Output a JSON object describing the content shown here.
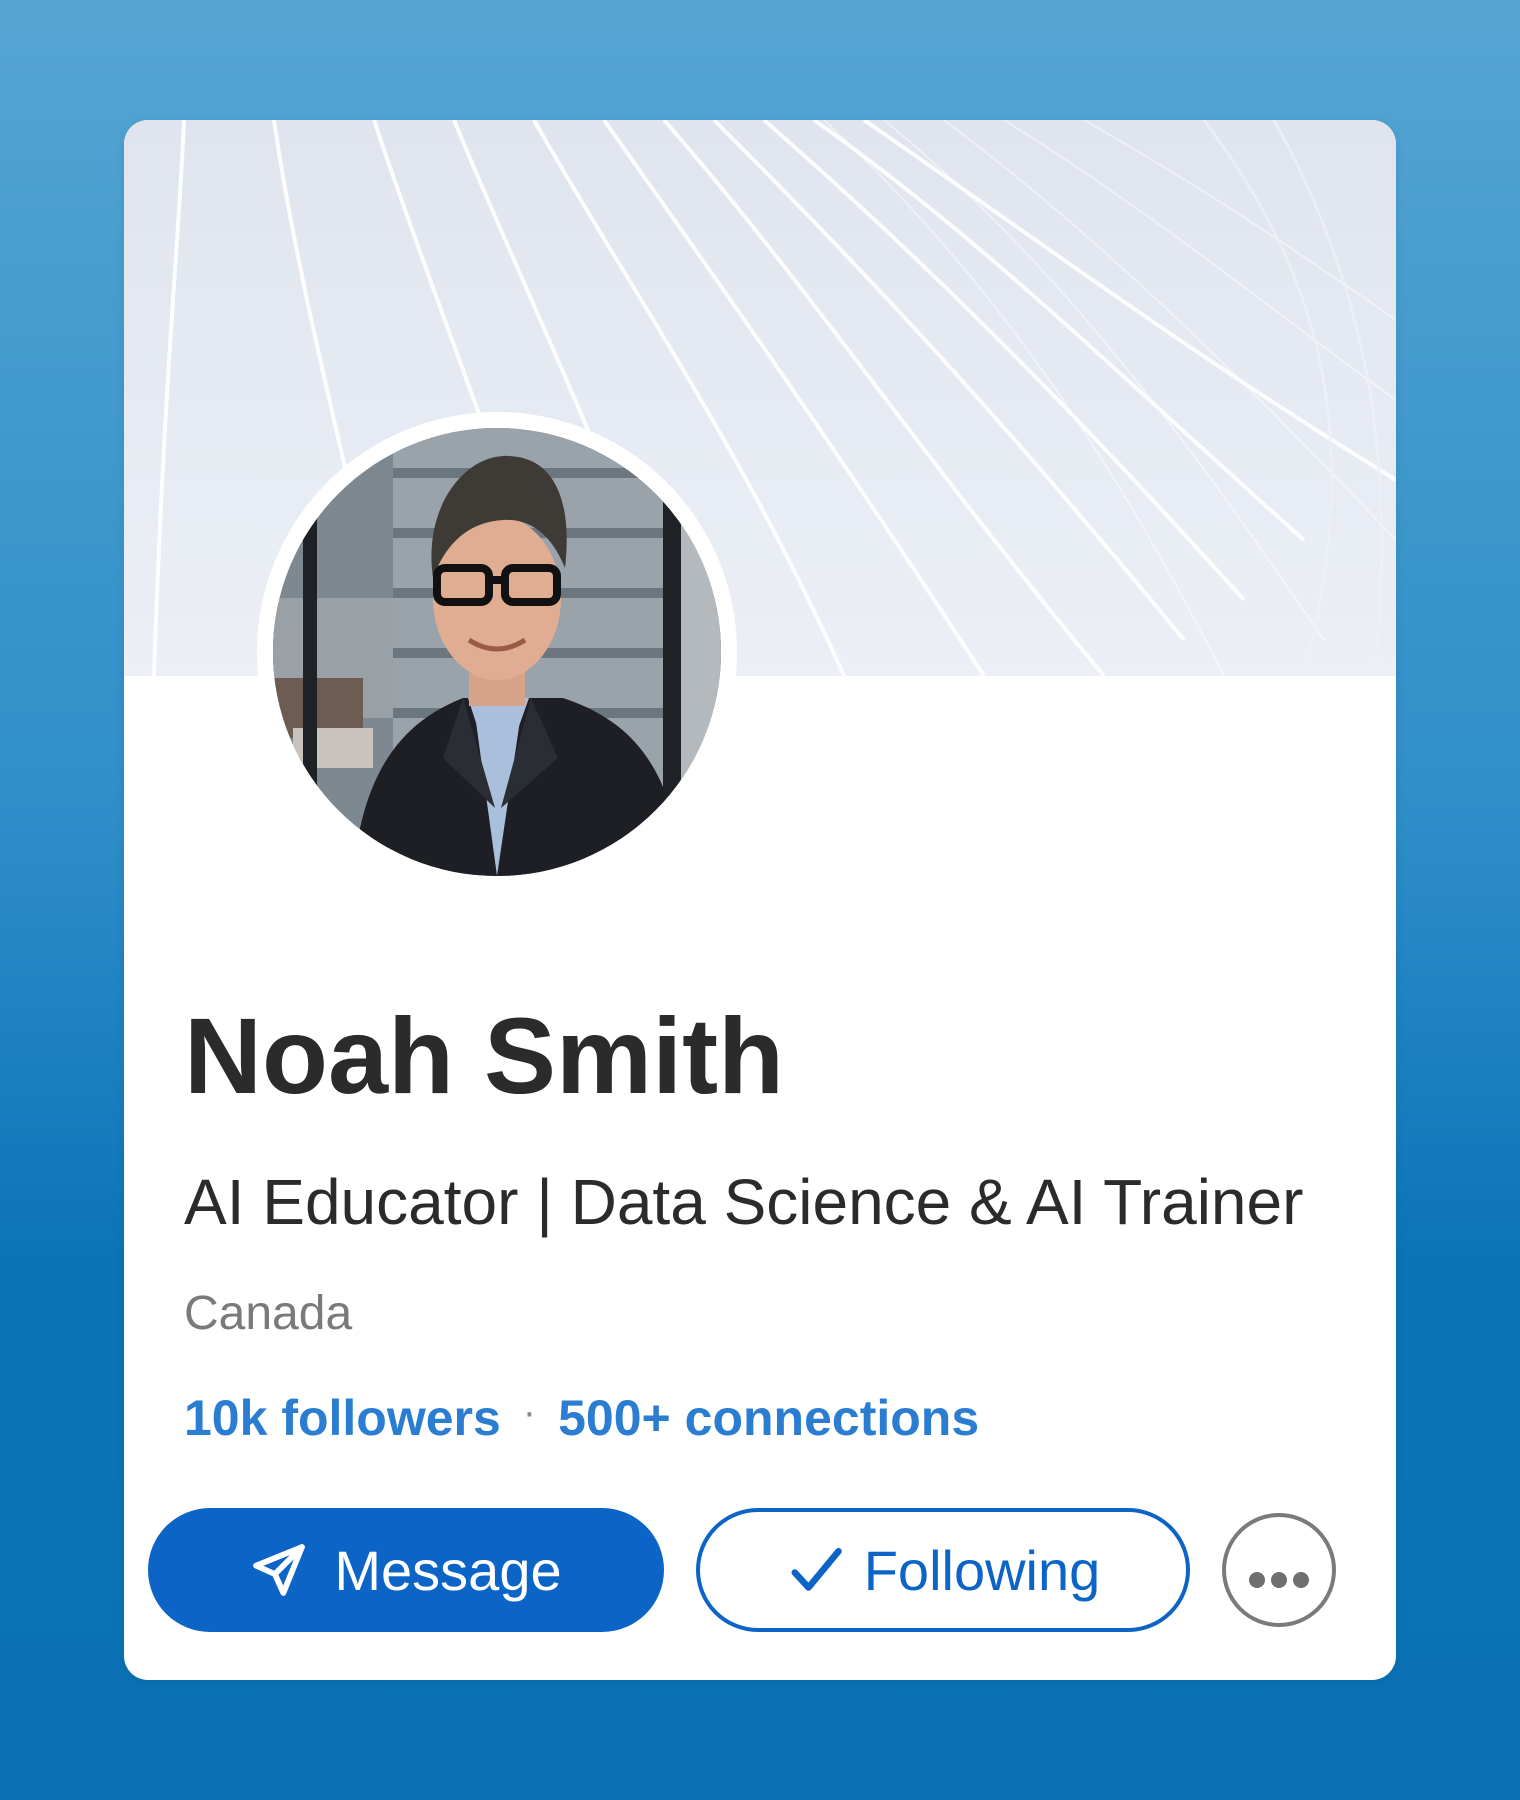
{
  "profile": {
    "name": "Noah Smith",
    "headline": "AI Educator | Data Science & AI Trainer",
    "location": "Canada",
    "followers": "10k followers",
    "separator": "·",
    "connections": "500+ connections"
  },
  "actions": {
    "message_label": "Message",
    "following_label": "Following",
    "more_icon": "more-horizontal-icon",
    "message_icon": "send-icon",
    "following_icon": "checkmark-icon"
  },
  "colors": {
    "background_top": "#55a5d2",
    "background_bottom": "#0a72b3",
    "primary": "#0b64c6",
    "link": "#2a7dd1",
    "name_text": "#2b2b2b",
    "muted_text": "#7a7a7a"
  }
}
